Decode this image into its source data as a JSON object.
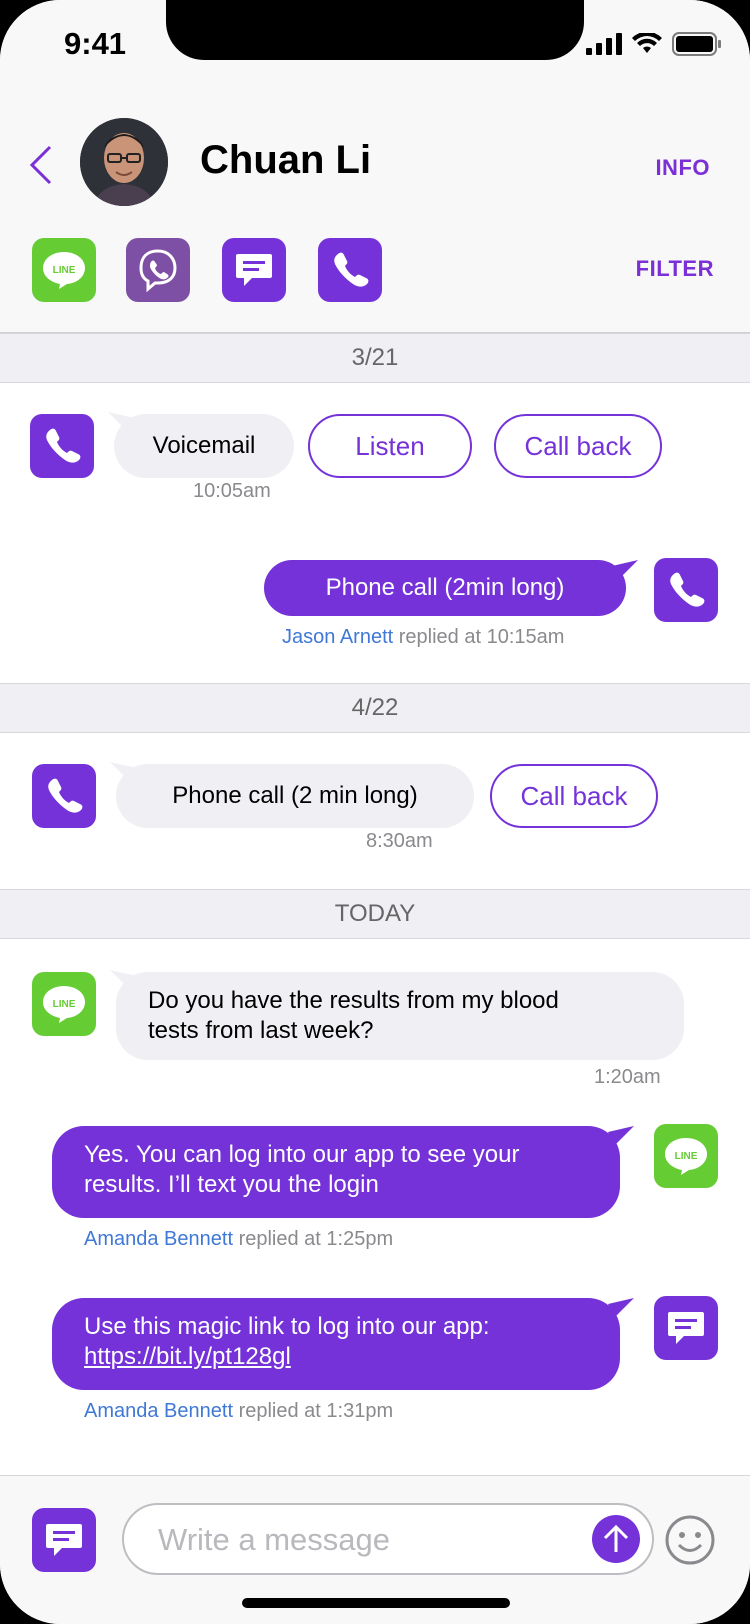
{
  "status": {
    "time": "9:41"
  },
  "header": {
    "contact_name": "Chuan Li",
    "info_label": "INFO",
    "filter_label": "FILTER",
    "channels": [
      "LINE",
      "Viber",
      "SMS",
      "Phone"
    ]
  },
  "sections": [
    {
      "date": "3/21"
    },
    {
      "date": "4/22"
    },
    {
      "date": "TODAY"
    }
  ],
  "messages": {
    "m1": {
      "text": "Voicemail",
      "time": "10:05am",
      "actions": [
        "Listen",
        "Call back"
      ]
    },
    "m2": {
      "text": "Phone call (2min long)",
      "agent": "Jason Arnett",
      "replied": "replied at 10:15am"
    },
    "m3": {
      "text": "Phone call (2 min long)",
      "time": "8:30am",
      "action": "Call back"
    },
    "m4": {
      "text_line1": "Do you have the results from my blood",
      "text_line2": "tests from last week?",
      "time": "1:20am"
    },
    "m5": {
      "text_line1": "Yes. You can log into our app to see your",
      "text_line2": "results. I’ll text you the login",
      "agent": "Amanda Bennett",
      "replied": "replied at 1:25pm"
    },
    "m6": {
      "text_line1": "Use this magic link to log into our app:",
      "link": "https://bit.ly/pt128gl",
      "agent": "Amanda Bennett",
      "replied": "replied at 1:31pm"
    }
  },
  "composer": {
    "placeholder": "Write a message"
  },
  "colors": {
    "accent": "#7432d8",
    "line_green": "#66cc33",
    "viber": "#7d4fa5",
    "agent_blue": "#3f78d6"
  }
}
